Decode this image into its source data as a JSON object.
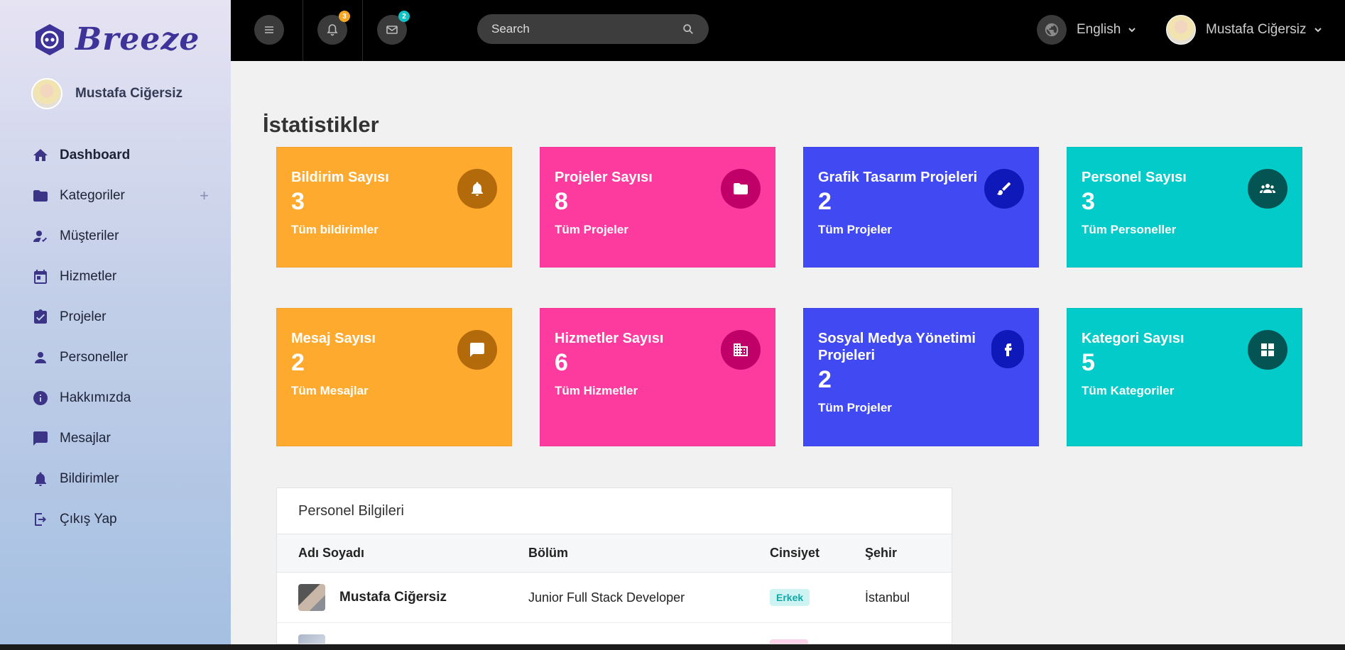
{
  "brand": {
    "name": "Breeze"
  },
  "sidebar": {
    "user_name": "Mustafa Ciğersiz",
    "items": [
      {
        "label": "Dashboard",
        "icon": "home-icon"
      },
      {
        "label": "Kategoriler",
        "icon": "folder-icon",
        "expand": "+"
      },
      {
        "label": "Müşteriler",
        "icon": "user-check-icon"
      },
      {
        "label": "Hizmetler",
        "icon": "calendar-icon"
      },
      {
        "label": "Projeler",
        "icon": "clipboard-check-icon"
      },
      {
        "label": "Personeller",
        "icon": "person-icon"
      },
      {
        "label": "Hakkımızda",
        "icon": "info-icon"
      },
      {
        "label": "Mesajlar",
        "icon": "chat-icon"
      },
      {
        "label": "Bildirimler",
        "icon": "bell-icon"
      },
      {
        "label": "Çıkış Yap",
        "icon": "logout-icon"
      }
    ]
  },
  "topbar": {
    "notifications_count": "3",
    "messages_count": "2",
    "search_placeholder": "Search",
    "language": "English",
    "user_name": "Mustafa Ciğersiz",
    "colors": {
      "notif_badge": "#f5a623",
      "msg_badge": "#11c1c6"
    }
  },
  "page_title": "İstatistikler",
  "cards": [
    {
      "title": "Bildirim Sayısı",
      "value": "3",
      "link": "Tüm bildirimler",
      "color": "orange",
      "icon": "bell-icon"
    },
    {
      "title": "Projeler Sayısı",
      "value": "8",
      "link": "Tüm Projeler",
      "color": "pink",
      "icon": "folder-icon"
    },
    {
      "title": "Grafik Tasarım Projeleri",
      "value": "2",
      "link": "Tüm Projeler",
      "color": "blue",
      "icon": "brush-icon"
    },
    {
      "title": "Personel Sayısı",
      "value": "3",
      "link": "Tüm Personeller",
      "color": "teal",
      "icon": "group-icon"
    },
    {
      "title": "Mesaj Sayısı",
      "value": "2",
      "link": "Tüm Mesajlar",
      "color": "orange",
      "icon": "chat-icon"
    },
    {
      "title": "Hizmetler Sayısı",
      "value": "6",
      "link": "Tüm Hizmetler",
      "color": "pink",
      "icon": "building-icon"
    },
    {
      "title": "Sosyal Medya Yönetimi Projeleri",
      "value": "2",
      "link": "Tüm Projeler",
      "color": "blue",
      "icon": "facebook-icon"
    },
    {
      "title": "Kategori Sayısı",
      "value": "5",
      "link": "Tüm Kategoriler",
      "color": "teal",
      "icon": "grid-icon"
    }
  ],
  "staff_table": {
    "title": "Personel Bilgileri",
    "columns": [
      "Adı Soyadı",
      "Bölüm",
      "Cinsiyet",
      "Şehir"
    ],
    "rows": [
      {
        "name": "Mustafa Ciğersiz",
        "department": "Junior Full Stack Developer",
        "gender": "Erkek",
        "city": "İstanbul"
      }
    ]
  }
}
